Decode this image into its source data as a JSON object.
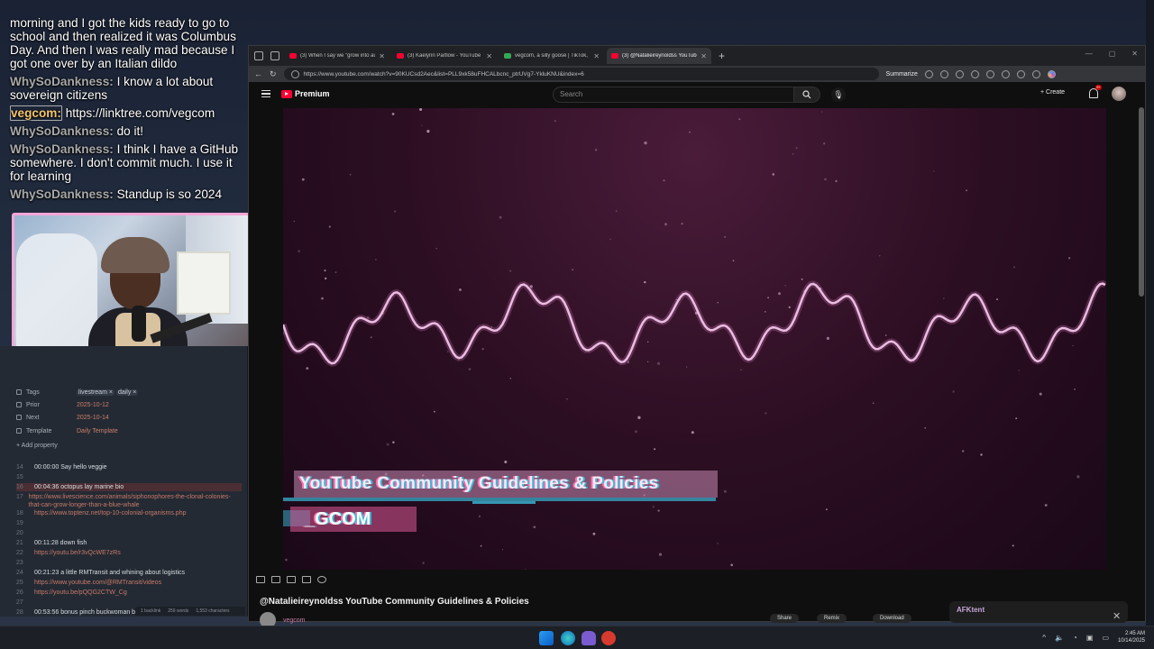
{
  "chat": [
    {
      "user": "",
      "text": "morning and I got the kids ready to go to school and then realized it was Columbus Day. And then I was really mad because I got one over by an Italian dildo"
    },
    {
      "user": "WhySoDankness:",
      "text": "I know a lot about sovereign citizens"
    },
    {
      "user": "vegcom:",
      "text": "https://linktree.com/vegcom"
    },
    {
      "user": "WhySoDankness:",
      "text": "do it!"
    },
    {
      "user": "WhySoDankness:",
      "text": "I think I have a GitHub somewhere. I don't commit much. I use it for learning"
    },
    {
      "user": "WhySoDankness:",
      "text": "Standup is so 2024"
    }
  ],
  "notes": {
    "properties": {
      "tags_label": "Tags",
      "tags": [
        "livestream ×",
        "daily ×"
      ],
      "prior_label": "Prior",
      "prior_value": "2025-10-12",
      "next_label": "Next",
      "next_value": "2025-10-14",
      "template_label": "Template",
      "template_value": "Daily Template",
      "add_property": "+ Add property"
    },
    "lines": [
      {
        "num": "14",
        "text": "00:00:00 Say hello veggie",
        "link": false
      },
      {
        "num": "15",
        "text": "",
        "link": false
      },
      {
        "num": "16",
        "text": "00:04:36 octopus lay marine bio",
        "link": false
      },
      {
        "num": "17",
        "text": "https://www.livescience.com/animals/siphonophores-the-clonal-colonies-that-can-grow-longer-than-a-blue-whale",
        "link": true
      },
      {
        "num": "18",
        "text": "https://www.toptenz.net/top-10-colonial-organisms.php",
        "link": true
      },
      {
        "num": "19",
        "text": "",
        "link": false
      },
      {
        "num": "20",
        "text": "",
        "link": false
      },
      {
        "num": "21",
        "text": "00:11:28  down fish",
        "link": false
      },
      {
        "num": "22",
        "text": "https://youtu.be/r3vQcWE7zRs",
        "link": true
      },
      {
        "num": "23",
        "text": "",
        "link": false
      },
      {
        "num": "24",
        "text": "00:21:23 a little RMTransit and whining about logistics",
        "link": false
      },
      {
        "num": "25",
        "text": "https://www.youtube.com/@RMTransit/videos",
        "link": true
      },
      {
        "num": "26",
        "text": "https://youtu.be/pQQG2CTW_Cg",
        "link": true
      },
      {
        "num": "27",
        "text": "",
        "link": false
      },
      {
        "num": "28",
        "text": "00:53:56 bonus pinch buckwoman bin",
        "link": false
      }
    ],
    "status": {
      "backlink": "1 backlink",
      "words": "259 words",
      "chars": "1,553 characters"
    }
  },
  "browser": {
    "tabs": [
      {
        "title": "(3) When I say we \"grow into auti",
        "favicon": "yt",
        "active": false
      },
      {
        "title": "(3) Kaelynn Partlow - YouTube",
        "favicon": "yt",
        "active": false
      },
      {
        "title": "vegcom, a silly goose | TikTok, Tw",
        "favicon": "green",
        "active": false
      },
      {
        "title": "(3) @Natalieireynoldss YouTube",
        "favicon": "yt",
        "active": true
      }
    ],
    "new_tab": "+",
    "url": "https://www.youtube.com/watch?v=90KUCsd2Aec&list=PLL9xk58uFHCALbcnc_ptrUVg7-YkluKNU&index=6",
    "summarize": "Summarize"
  },
  "youtube": {
    "logo": "Premium",
    "search_placeholder": "Search",
    "create": "+ Create",
    "notif_count": "9+",
    "overlay_title": "YouTube Community Guidelines & Policies",
    "overlay_sub": "_GCOM",
    "video_title": "@Natalieireynoldss YouTube Community Guidelines & Policies",
    "channel": "vegcom",
    "actions": [
      "Share",
      "Remix",
      "Download"
    ],
    "afk": "AFKtent"
  },
  "taskbar": {
    "time": "2:45 AM",
    "date": "10/14/2025"
  },
  "colors": {
    "accent": "#f7a6d8",
    "yt_red": "#ff0033",
    "wave": "#e8bde0"
  }
}
